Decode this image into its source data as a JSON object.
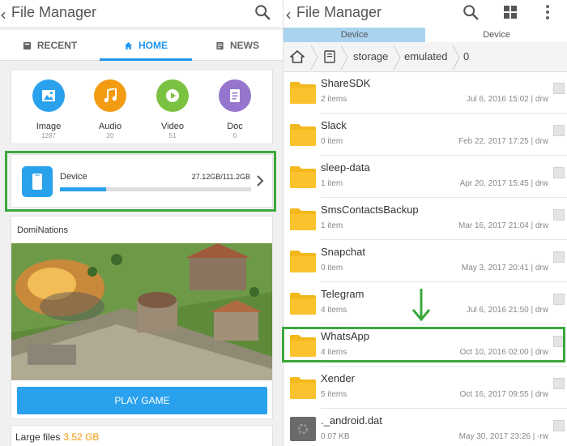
{
  "left": {
    "title": "File Manager",
    "back_glyph": "‹",
    "tabs": [
      {
        "label": "RECENT",
        "icon": "recent-icon"
      },
      {
        "label": "HOME",
        "icon": "home-icon"
      },
      {
        "label": "NEWS",
        "icon": "news-icon"
      }
    ],
    "categories": [
      {
        "label": "Image",
        "count": "1287",
        "color": "#2aa1ec",
        "icon": "image-icon"
      },
      {
        "label": "Audio",
        "count": "20",
        "color": "#f39c12",
        "icon": "music-icon"
      },
      {
        "label": "Video",
        "count": "51",
        "color": "#7cc242",
        "icon": "play-icon"
      },
      {
        "label": "Doc",
        "count": "0",
        "color": "#9575cd",
        "icon": "document-icon"
      }
    ],
    "device": {
      "label": "Device",
      "size": "27.12GB/111.2GB",
      "used_fraction": 0.24
    },
    "game": {
      "name": "DomiNations",
      "button": "PLAY GAME"
    },
    "large_files": {
      "label": "Large files",
      "size": "3.52 GB"
    }
  },
  "right": {
    "title": "File Manager",
    "back_glyph": "‹",
    "device_tabs": [
      "Device",
      "Device"
    ],
    "path": [
      "storage",
      "emulated",
      "0"
    ],
    "files": [
      {
        "name": "ShareSDK",
        "sub": "2 items",
        "date": "Jul 6, 2016 15:02 | drw",
        "type": "folder"
      },
      {
        "name": "Slack",
        "sub": "0 item",
        "date": "Feb 22, 2017 17:25 | drw",
        "type": "folder"
      },
      {
        "name": "sleep-data",
        "sub": "1 item",
        "date": "Apr 20, 2017 15:45 | drw",
        "type": "folder"
      },
      {
        "name": "SmsContactsBackup",
        "sub": "1 item",
        "date": "Mar 16, 2017 21:04 | drw",
        "type": "folder"
      },
      {
        "name": "Snapchat",
        "sub": "0 item",
        "date": "May 3, 2017 20:41 | drw",
        "type": "folder"
      },
      {
        "name": "Telegram",
        "sub": "4 items",
        "date": "Jul 6, 2016 21:50 | drw",
        "type": "folder"
      },
      {
        "name": "WhatsApp",
        "sub": "4 items",
        "date": "Oct 10, 2016 02:00 | drw",
        "type": "folder"
      },
      {
        "name": "Xender",
        "sub": "5 items",
        "date": "Oct 16, 2017 09:55 | drw",
        "type": "folder"
      },
      {
        "name": "._android.dat",
        "sub": "0.07 KB",
        "date": "May 30, 2017 23:26 | -rw",
        "type": "file"
      }
    ]
  },
  "colors": {
    "accent": "#2196f3",
    "highlight": "#3ca83c",
    "folder": "#f9c22e"
  }
}
